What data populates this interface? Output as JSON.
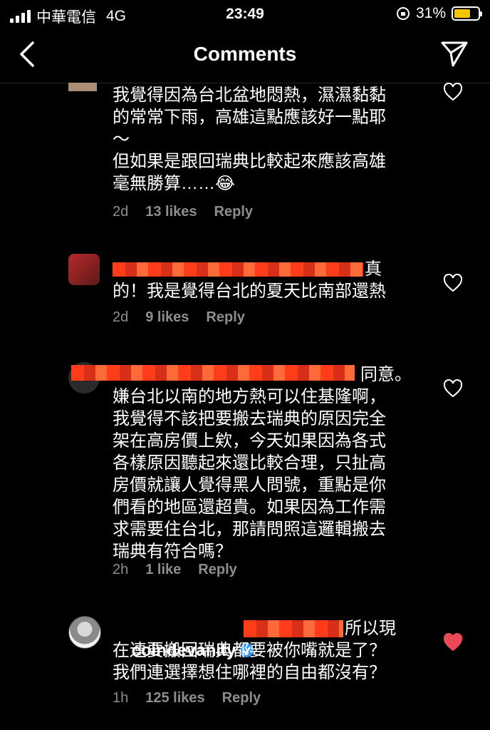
{
  "status_bar": {
    "carrier": "中華電信",
    "network": "4G",
    "time": "23:49",
    "battery": "31%"
  },
  "header": {
    "title": "Comments"
  },
  "comments": [
    {
      "text": "我覺得因為台北盆地悶熱，濕濕黏黏\n的常常下雨，高雄這點應該好一點耶\n～\n但如果是跟回瑞典比較起來應該高雄\n毫無勝算……😂",
      "time": "2d",
      "likes": "13 likes",
      "reply": "Reply"
    },
    {
      "text_tail": "真",
      "text_rest": "的！我是覺得台北的夏天比南部還熱",
      "time": "2d",
      "likes": "9 likes",
      "reply": "Reply"
    },
    {
      "text_tail": "同意。",
      "text_rest": "嫌台北以南的地方熱可以住基隆啊，\n我覺得不該把要搬去瑞典的原因完全\n架在高房價上欸，今天如果因為各式\n各樣原因聽起來還比較合理，只扯高\n房價就讓人覺得黑人問號，重點是你\n們看的地區還超貴。如果因為工作需\n求需要住台北，那請問照這邏輯搬去\n瑞典有符合嗎？",
      "time": "2h",
      "likes": "1 like",
      "reply": "Reply"
    },
    {
      "username": "coindevanity",
      "text_tail": "所以現",
      "text_rest": "在連要搬回瑞典都要被你嘴就是了？\n我們連選擇想住哪裡的自由都沒有？",
      "time": "1h",
      "likes": "125 likes",
      "reply": "Reply"
    }
  ],
  "colors": {
    "liked_heart": "#ed4956",
    "muted_text": "#8e8e8e",
    "redaction": "#ff3b14",
    "verified": "#3897f0"
  }
}
